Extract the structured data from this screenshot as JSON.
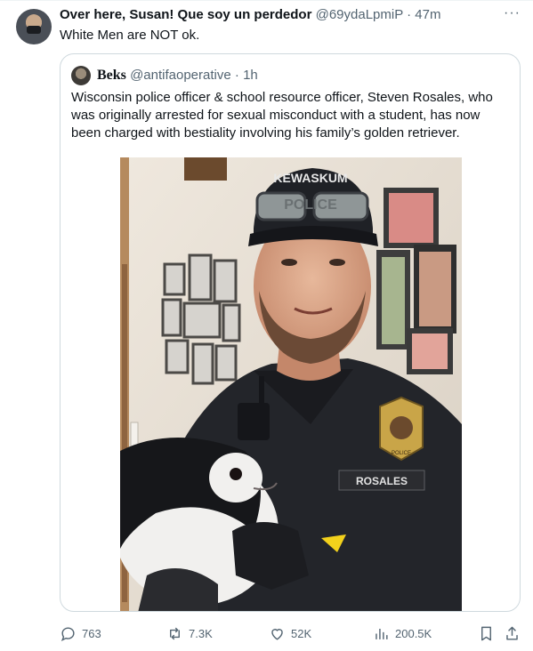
{
  "tweet": {
    "author_name": "Over here, Susan! Que soy un perdedor",
    "author_handle": "@69ydaLpmiP",
    "separator": "·",
    "time": "47m",
    "more_label": "···",
    "text": "White Men are NOT ok."
  },
  "quoted": {
    "author_name": "Beks",
    "author_handle": "@antifaoperative",
    "separator": "·",
    "time": "1h",
    "text": "Wisconsin police officer & school resource officer, Steven Rosales, who was originally arrested for sexual misconduct with a student, has now been charged with bestiality involving his family’s golden retriever.",
    "photo": {
      "cap_text": "KEWASKUM",
      "cap_sub": "POLICE",
      "nameplate": "ROSALES",
      "badge_text": "POLICE"
    }
  },
  "actions": {
    "replies": "763",
    "reposts": "7.3K",
    "likes": "52K",
    "views": "200.5K"
  },
  "icons": {
    "reply": "reply-icon",
    "repost": "repost-icon",
    "like": "heart-icon",
    "views": "views-icon",
    "bookmark": "bookmark-icon",
    "share": "share-icon",
    "more": "more-icon"
  },
  "colors": {
    "text_primary": "#0f1419",
    "text_secondary": "#536471",
    "border": "#cfd9de"
  }
}
